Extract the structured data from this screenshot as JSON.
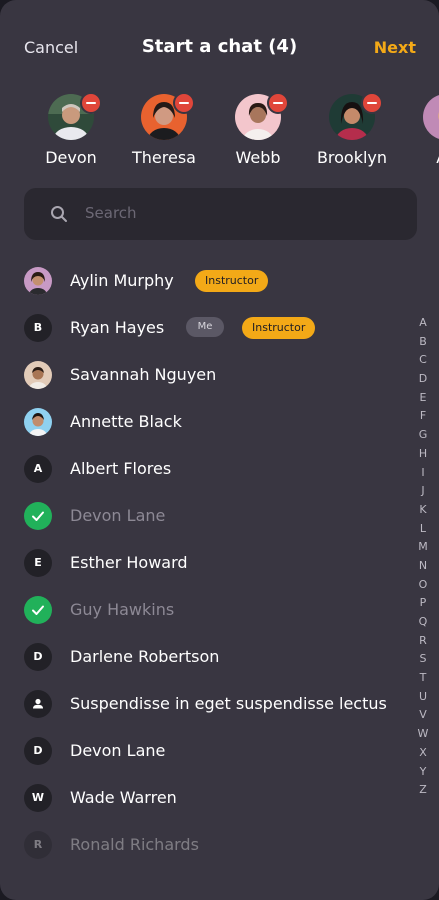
{
  "header": {
    "cancel_label": "Cancel",
    "title": "Start a chat (4)",
    "next_label": "Next"
  },
  "selected": [
    {
      "name": "Devon"
    },
    {
      "name": "Theresa"
    },
    {
      "name": "Webb"
    },
    {
      "name": "Brooklyn"
    },
    {
      "name": "Av"
    }
  ],
  "search": {
    "placeholder": "Search",
    "icon": "search-icon"
  },
  "contacts": [
    {
      "name": "Aylin Murphy",
      "avatar": "photo",
      "badges": [
        "Instructor"
      ]
    },
    {
      "name": "Ryan Hayes",
      "avatar": "letter",
      "initial": "B",
      "me": "Me",
      "badges": [
        "Instructor"
      ]
    },
    {
      "name": "Savannah Nguyen",
      "avatar": "photo"
    },
    {
      "name": "Annette Black",
      "avatar": "photo"
    },
    {
      "name": "Albert Flores",
      "avatar": "letter",
      "initial": "A"
    },
    {
      "name": "Devon Lane",
      "avatar": "check",
      "selected": true
    },
    {
      "name": "Esther Howard",
      "avatar": "letter",
      "initial": "E"
    },
    {
      "name": "Guy Hawkins",
      "avatar": "check",
      "selected": true
    },
    {
      "name": "Darlene Robertson",
      "avatar": "letter",
      "initial": "D"
    },
    {
      "name": "Suspendisse in eget suspendisse lectus",
      "avatar": "group"
    },
    {
      "name": "Devon Lane",
      "avatar": "letter",
      "initial": "D"
    },
    {
      "name": "Wade Warren",
      "avatar": "letter",
      "initial": "W"
    },
    {
      "name": "Ronald Richards",
      "avatar": "letter",
      "initial": "R"
    }
  ],
  "alphabet": [
    "A",
    "B",
    "C",
    "D",
    "E",
    "F",
    "G",
    "H",
    "I",
    "J",
    "K",
    "L",
    "M",
    "N",
    "O",
    "P",
    "Q",
    "R",
    "S",
    "T",
    "U",
    "V",
    "W",
    "X",
    "Y",
    "Z"
  ],
  "colors": {
    "accent": "#f3a917",
    "remove": "#e0463a",
    "selected_check": "#21b15a",
    "panel": "#393641"
  }
}
